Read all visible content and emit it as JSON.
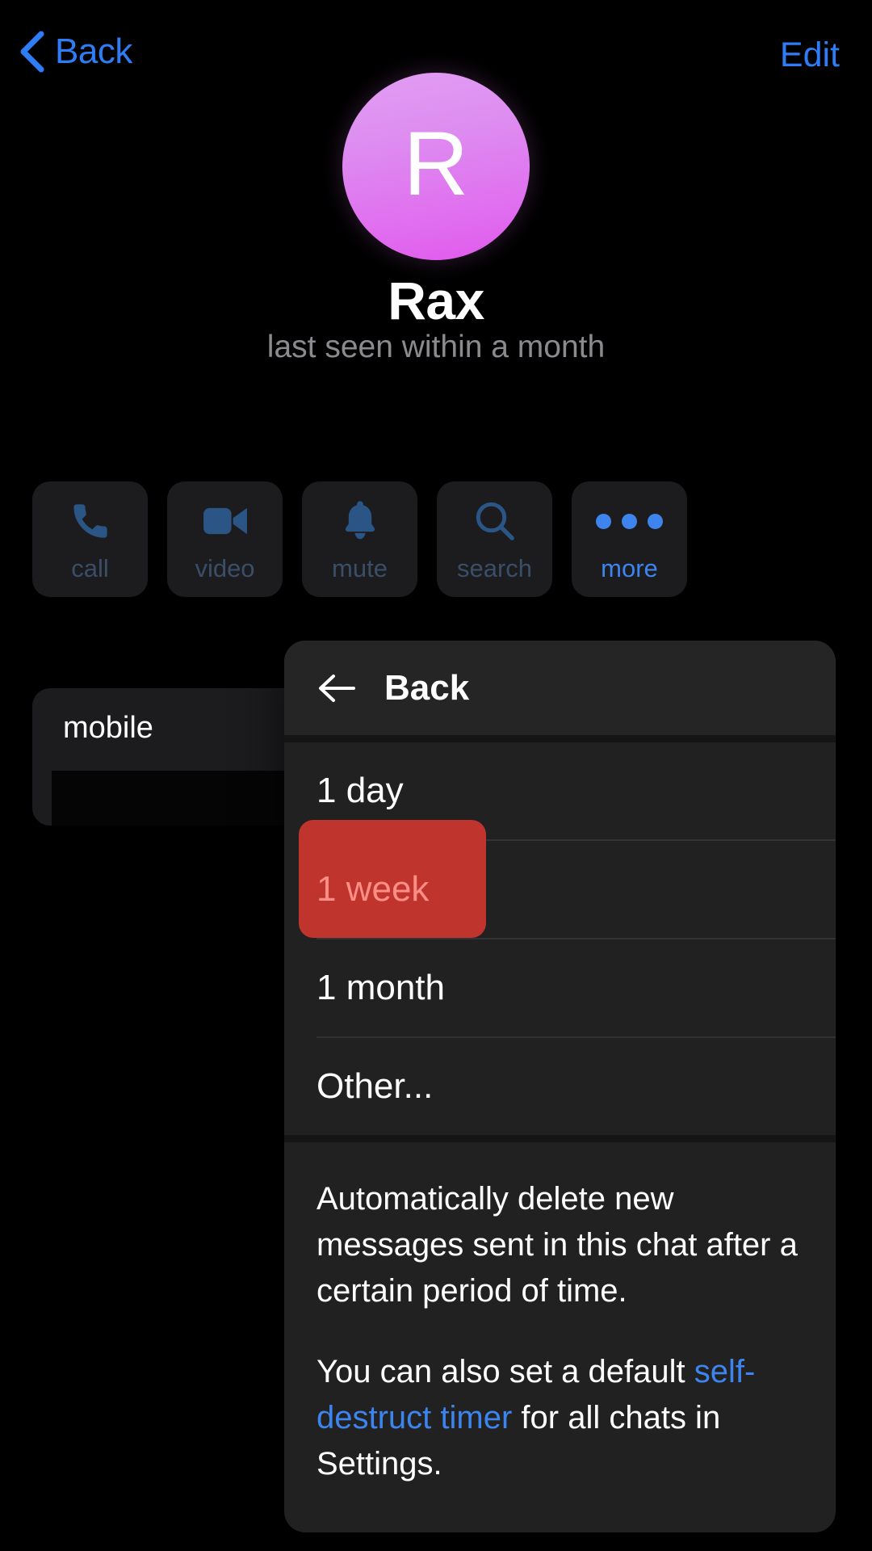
{
  "navbar": {
    "back_label": "Back",
    "back_icon": "chevron-left-icon",
    "edit_label": "Edit"
  },
  "profile": {
    "avatar_letter": "R",
    "avatar_color_top": "#e29ef3",
    "avatar_color_bottom": "#e159ee",
    "name": "Rax",
    "status": "last seen within a month"
  },
  "actions": [
    {
      "label": "call",
      "icon": "phone-icon",
      "state": "dim"
    },
    {
      "label": "video",
      "icon": "video-camera-icon",
      "state": "dim"
    },
    {
      "label": "mute",
      "icon": "bell-icon",
      "state": "dim"
    },
    {
      "label": "search",
      "icon": "magnifier-icon",
      "state": "dim"
    },
    {
      "label": "more",
      "icon": "ellipsis-icon",
      "state": "bright"
    }
  ],
  "info_card": {
    "label": "mobile",
    "value": ""
  },
  "context_menu": {
    "header": {
      "label": "Back",
      "icon": "arrow-left-icon"
    },
    "items": [
      {
        "label": "1 day",
        "selected": false
      },
      {
        "label": "1 week",
        "selected": true
      },
      {
        "label": "1 month",
        "selected": false
      },
      {
        "label": "Other...",
        "selected": false
      }
    ],
    "footer": {
      "paragraph1": "Automatically delete new messages sent in this chat after a certain period of time.",
      "paragraph2_pre": "You can also set a default ",
      "paragraph2_link": "self-destruct timer",
      "paragraph2_post": " for all chats in Settings."
    },
    "selection_color": "#c0342e",
    "selection_text_color": "#ff8f86",
    "link_color": "#3d84ee"
  }
}
